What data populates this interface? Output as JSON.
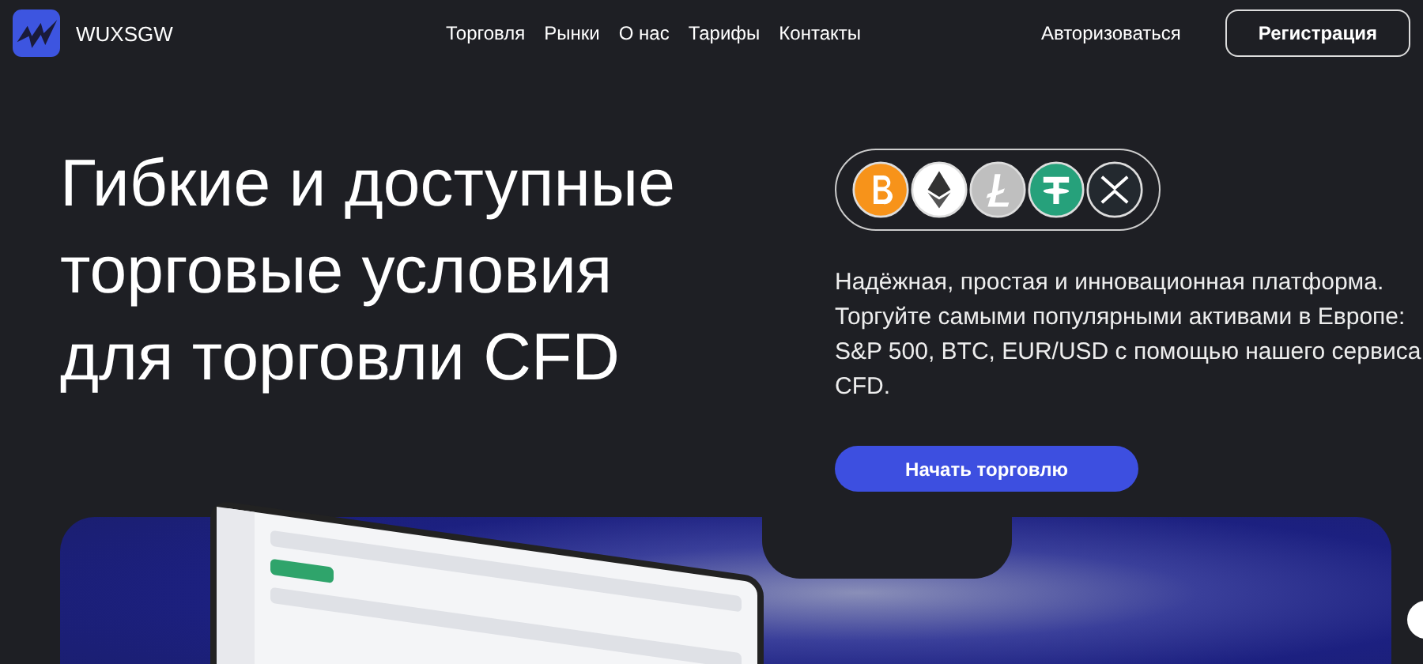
{
  "brand": {
    "name": "WUXSGW"
  },
  "nav": [
    {
      "label": "Торговля"
    },
    {
      "label": "Рынки"
    },
    {
      "label": "О нас"
    },
    {
      "label": "Тарифы"
    },
    {
      "label": "Контакты"
    }
  ],
  "auth": {
    "login": "Авторизоваться",
    "register": "Регистрация"
  },
  "hero": {
    "title_lines": [
      "Гибкие и доступные",
      "торговые условия",
      "для торговли CFD"
    ],
    "coins": [
      {
        "kind": "btc",
        "color": "#f7931a"
      },
      {
        "kind": "eth",
        "color": "#ffffff"
      },
      {
        "kind": "ltc",
        "color": "#bfbfbf"
      },
      {
        "kind": "usdt",
        "color": "#26a17b"
      },
      {
        "kind": "xrp",
        "color": "#23292f"
      }
    ],
    "description": "Надёжная, простая и инновационная платформа. Торгуйте самыми популярными активами в Европе: S&P 500, BTC, EUR/USD с помощью нашего сервиса CFD.",
    "cta": "Начать торговлю"
  }
}
